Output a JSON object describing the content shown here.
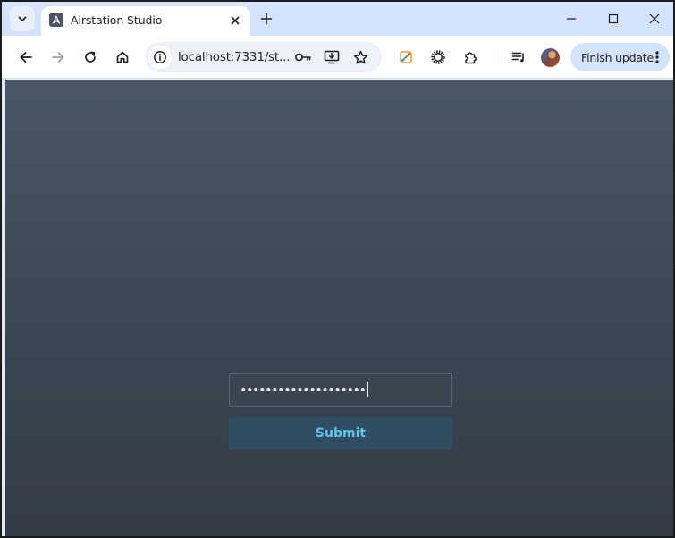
{
  "browser": {
    "tab": {
      "title": "Airstation Studio",
      "favicon": "airstation-logo-icon"
    },
    "address_bar": {
      "url": "localhost:7331/st..."
    },
    "update_button": {
      "label": "Finish update"
    },
    "icons": {
      "tab_search": "chevron-down-icon",
      "tab_close": "close-icon",
      "new_tab": "plus-icon",
      "minimize": "minimize-icon",
      "maximize": "maximize-icon",
      "close_window": "close-icon",
      "back": "arrow-left-icon",
      "forward": "arrow-right-icon",
      "reload": "reload-icon",
      "home": "home-icon",
      "site_info": "info-icon",
      "password_key": "key-icon",
      "install_app": "install-icon",
      "bookmark": "star-icon",
      "extension_color": "color-picker-icon",
      "extension_gear": "gear-icon",
      "extensions": "puzzle-icon",
      "reading_list": "playlist-icon",
      "menu": "kebab-menu-icon"
    },
    "colors": {
      "tabstrip": "#d3e3fd",
      "toolbar": "#ffffff"
    }
  },
  "page": {
    "password": {
      "masked_value": "••••••••••••••••••••"
    },
    "submit": {
      "label": "Submit"
    },
    "colors": {
      "background_top": "#4a5764",
      "background_bottom": "#333c46",
      "button_bg": "#2f4e62",
      "button_text": "#60c3ec"
    }
  }
}
